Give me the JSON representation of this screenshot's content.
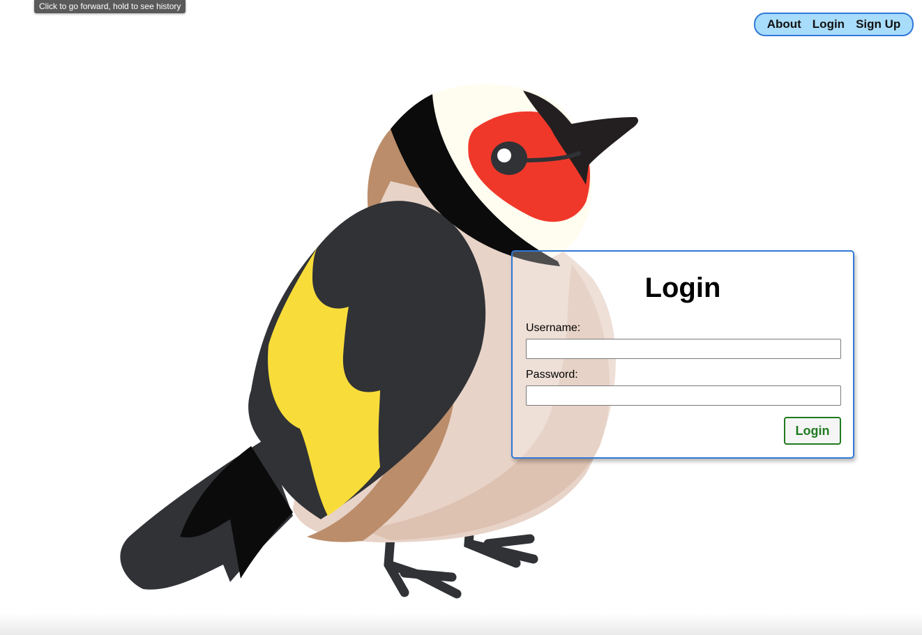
{
  "tooltip": {
    "text": "Click to go forward, hold to see history"
  },
  "nav": {
    "items": [
      {
        "label": "About"
      },
      {
        "label": "Login"
      },
      {
        "label": "Sign Up"
      }
    ]
  },
  "login_form": {
    "title": "Login",
    "username_label": "Username:",
    "username_value": "",
    "password_label": "Password:",
    "password_value": "",
    "submit_label": "Login"
  },
  "illustration": {
    "subject": "goldfinch-bird"
  },
  "colors": {
    "nav_bg": "#a8dcfb",
    "accent_border": "#2f78d8",
    "button_text": "#1f7a1f",
    "bird_red": "#f0382a",
    "bird_yellow": "#f8dc3a",
    "bird_dark": "#303236",
    "bird_brown": "#bb8d6b",
    "bird_breast": "#e8d3c8"
  }
}
